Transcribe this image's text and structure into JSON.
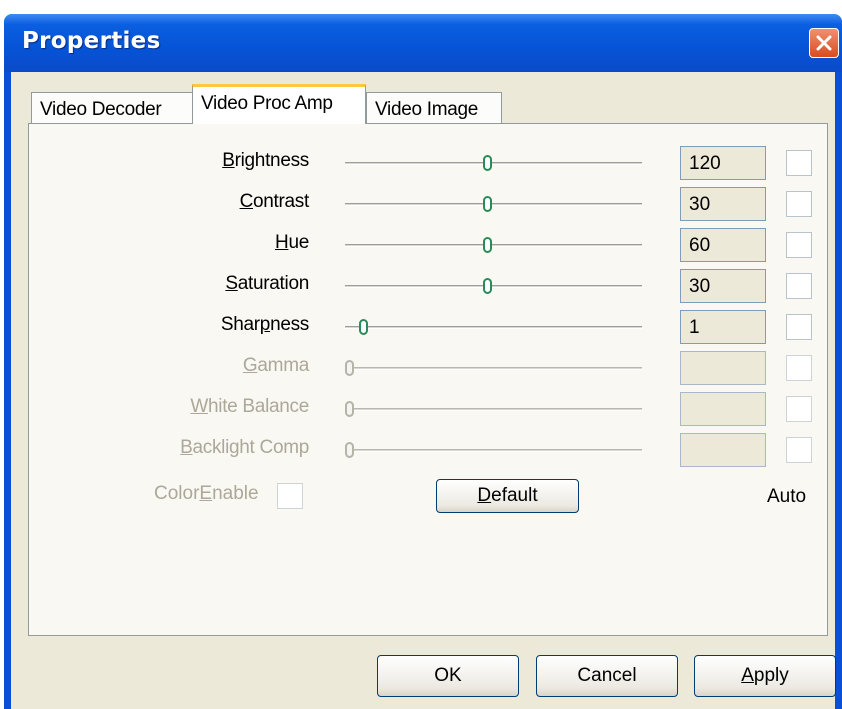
{
  "window": {
    "title": "Properties"
  },
  "tabs": [
    {
      "label": "Video Decoder",
      "active": false
    },
    {
      "label": "Video Proc Amp",
      "active": true
    },
    {
      "label": "Video Image",
      "active": false
    }
  ],
  "controls": [
    {
      "name": "brightness",
      "pre": "",
      "key": "B",
      "post": "rightness",
      "value": "120",
      "level": 0.48,
      "enabled": true
    },
    {
      "name": "contrast",
      "pre": "",
      "key": "C",
      "post": "ontrast",
      "value": "30",
      "level": 0.48,
      "enabled": true
    },
    {
      "name": "hue",
      "pre": "",
      "key": "H",
      "post": "ue",
      "value": "60",
      "level": 0.48,
      "enabled": true
    },
    {
      "name": "saturation",
      "pre": "",
      "key": "S",
      "post": "aturation",
      "value": "30",
      "level": 0.48,
      "enabled": true
    },
    {
      "name": "sharpness",
      "pre": "Shar",
      "key": "p",
      "post": "ness",
      "value": "1",
      "level": 0.05,
      "enabled": true
    },
    {
      "name": "gamma",
      "pre": "",
      "key": "G",
      "post": "amma",
      "value": "",
      "level": 0.0,
      "enabled": false
    },
    {
      "name": "white-balance",
      "pre": "",
      "key": "W",
      "post": "hite Balance",
      "value": "",
      "level": 0.0,
      "enabled": false
    },
    {
      "name": "backlight-comp",
      "pre": "",
      "key": "B",
      "post": "acklight Comp",
      "value": "",
      "level": 0.0,
      "enabled": false
    }
  ],
  "color_enable": {
    "pre": "Color",
    "key": "E",
    "post": "nable",
    "checked": false,
    "enabled": false
  },
  "default_button": {
    "pre": "",
    "key": "D",
    "post": "efault"
  },
  "auto_label": "Auto",
  "buttons": {
    "ok": {
      "label": "OK"
    },
    "cancel": {
      "label": "Cancel"
    },
    "apply": {
      "pre": "",
      "key": "A",
      "post": "pply"
    }
  },
  "colors": {
    "titlebar": "#0653d6",
    "dialog_bg": "#ece9d8",
    "active_tab_accent": "#ffc83c",
    "close_button": "#d84c20"
  }
}
